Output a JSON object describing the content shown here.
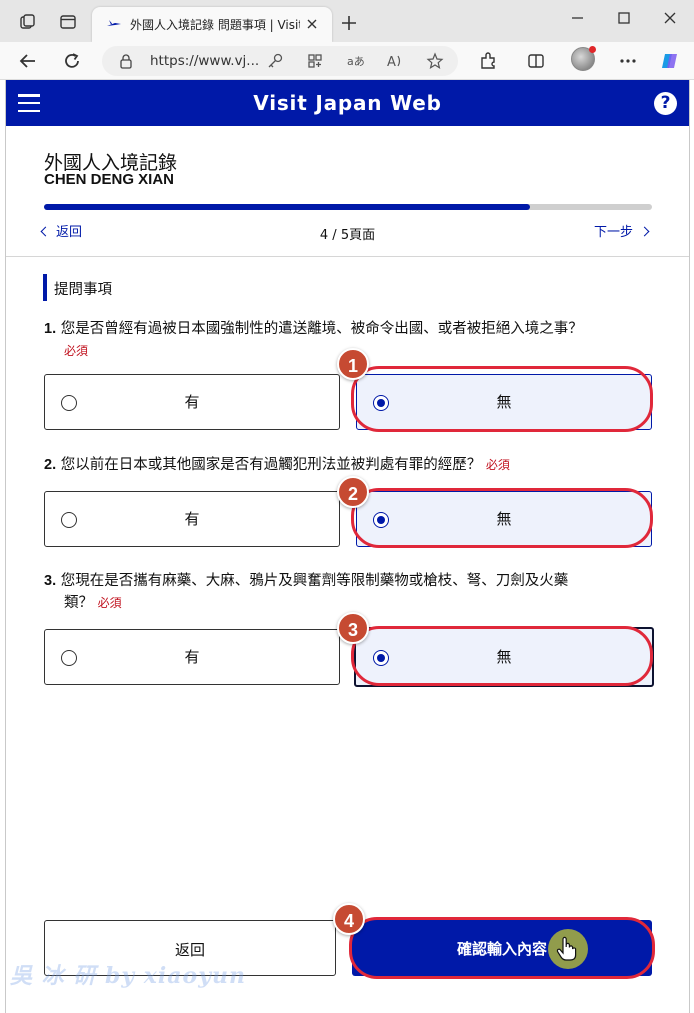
{
  "browser": {
    "tab_title": "外國人入境記錄 問題事項 | Visit J",
    "url": "https://www.vj...",
    "new_tab_symbol": "+",
    "accent_color": "#0019a8"
  },
  "header": {
    "title": "Visit Japan Web",
    "help_symbol": "?"
  },
  "form": {
    "title": "外國人入境記錄",
    "name": "CHEN DENG XIAN"
  },
  "progress": {
    "current_page": 4,
    "total_pages": 5,
    "fraction": 0.8
  },
  "nav": {
    "back_label": "返回",
    "page_label": "4 / 5頁面",
    "next_label": "下一步"
  },
  "section": {
    "title": "提問事項"
  },
  "questions": [
    {
      "number": "1.",
      "text": "您是否曾經有過被日本國強制性的遣送離境、被命令出國、或者被拒絕入境之事？",
      "required": "必須",
      "options": [
        {
          "label": "有",
          "selected": false
        },
        {
          "label": "無",
          "selected": true
        }
      ],
      "callout": "1"
    },
    {
      "number": "2.",
      "text": "您以前在日本或其他國家是否有過觸犯刑法並被判處有罪的經歷？",
      "required": "必須",
      "options": [
        {
          "label": "有",
          "selected": false
        },
        {
          "label": "無",
          "selected": true
        }
      ],
      "callout": "2"
    },
    {
      "number": "3.",
      "text_line1": "您現在是否攜有麻藥、大麻、鴉片及興奮劑等限制藥物或槍枝、弩、刀劍及火藥",
      "text_line2": "類？",
      "required": "必須",
      "options": [
        {
          "label": "有",
          "selected": false
        },
        {
          "label": "無",
          "selected": true
        }
      ],
      "callout": "3"
    }
  ],
  "footer": {
    "back_button": "返回",
    "confirm_button": "確認輸入內容",
    "callout": "4"
  },
  "icons": [
    "workspaces-icon",
    "tab-actions-icon",
    "back-icon",
    "refresh-icon",
    "lock-icon",
    "key-icon",
    "app-icon",
    "read-aloud-icon",
    "translate-icon",
    "favorite-icon",
    "extensions-icon",
    "split-screen-icon",
    "more-icon",
    "copilot-icon",
    "minimize-icon",
    "maximize-icon",
    "close-icon",
    "hamburger-icon",
    "help-icon",
    "hand-cursor-icon"
  ]
}
